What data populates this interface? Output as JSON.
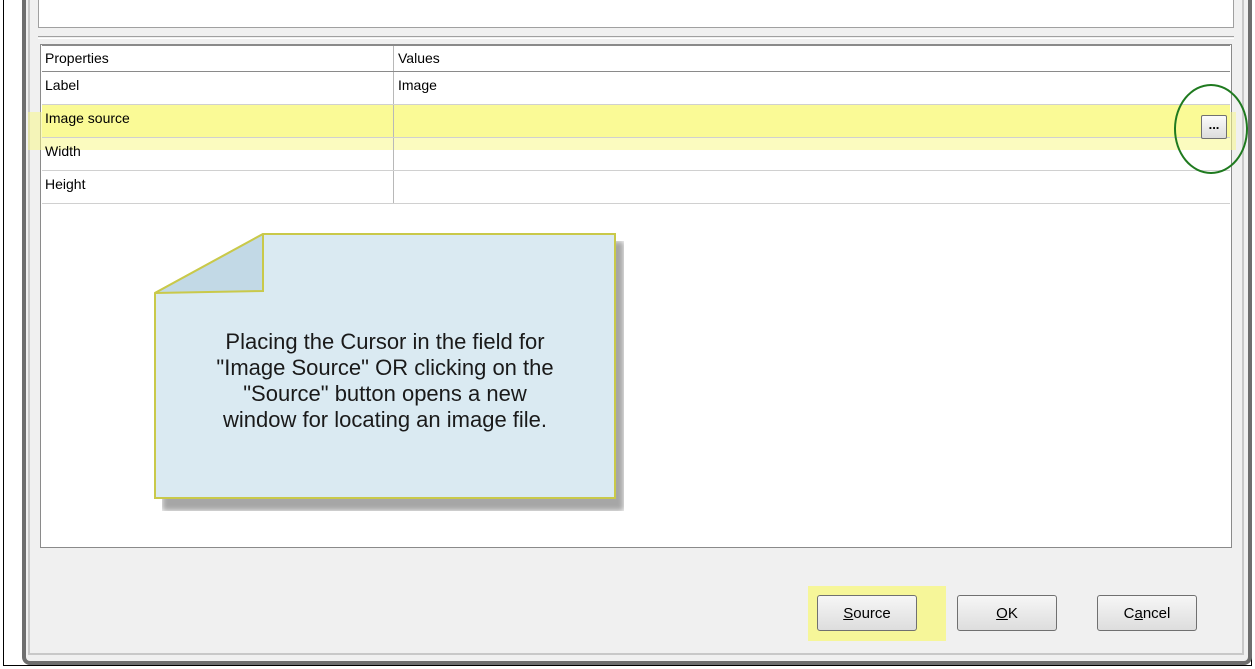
{
  "grid": {
    "headers": {
      "properties": "Properties",
      "values": "Values"
    },
    "rows": [
      {
        "property": "Label",
        "value": "Image"
      },
      {
        "property": "Image source",
        "value": ""
      },
      {
        "property": "Width",
        "value": ""
      },
      {
        "property": "Height",
        "value": ""
      }
    ],
    "ellipsis_label": "..."
  },
  "note": {
    "lines": [
      "Placing the Cursor in the field for",
      "\"Image Source\" OR clicking on the",
      "\"Source\" button opens a new",
      "window for locating an image file."
    ]
  },
  "buttons": {
    "source": {
      "accel": "S",
      "rest": "ource"
    },
    "ok": {
      "accel": "O",
      "rest": "K"
    },
    "cancel": {
      "pre": "C",
      "accel": "a",
      "rest": "ncel"
    }
  },
  "colors": {
    "highlight": "#f7f78a",
    "note_fill": "#daeaf2",
    "note_border": "#c9c94a",
    "circle": "#1f7a1f"
  }
}
